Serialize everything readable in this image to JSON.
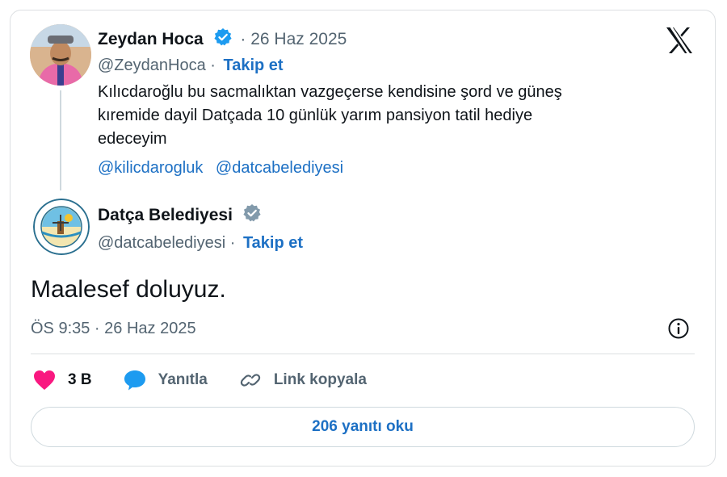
{
  "quoted_tweet": {
    "author_name": "Zeydan Hoca",
    "date": "· 26 Haz 2025",
    "handle": "@ZeydanHoca ·",
    "follow_label": "Takip et",
    "text_lines": [
      "Kılıcdaroğlu bu sacmalıktan  vazgeçerse  kendisine şord ve güneş",
      "kıremide dayil Datçada  10 günlük yarım pansiyon tatil hediye",
      "edeceyim"
    ],
    "mentions": [
      "@kilicdarogluk",
      "@datcabelediyesi"
    ],
    "verified_badge_color": "#1d9bf0"
  },
  "reply_tweet": {
    "author_name": "Datça Belediyesi",
    "handle": "@datcabelediyesi ·",
    "follow_label": "Takip et",
    "text": "Maalesef doluyuz.",
    "timestamp": "ÖS 9:35 · 26 Haz 2025",
    "verified_badge_color": "#829aab"
  },
  "actions": {
    "like_count": "3 B",
    "reply_label": "Yanıtla",
    "copy_link_label": "Link kopyala"
  },
  "read_replies_label": "206 yanıtı oku",
  "icons": {
    "brand": "x-logo-icon",
    "info": "info-icon",
    "like": "heart-icon",
    "reply": "speech-bubble-icon",
    "link": "link-icon"
  },
  "colors": {
    "link": "#1d70c4",
    "muted": "#536471",
    "heart": "#f91880",
    "reply_bubble": "#1d9bf0"
  }
}
